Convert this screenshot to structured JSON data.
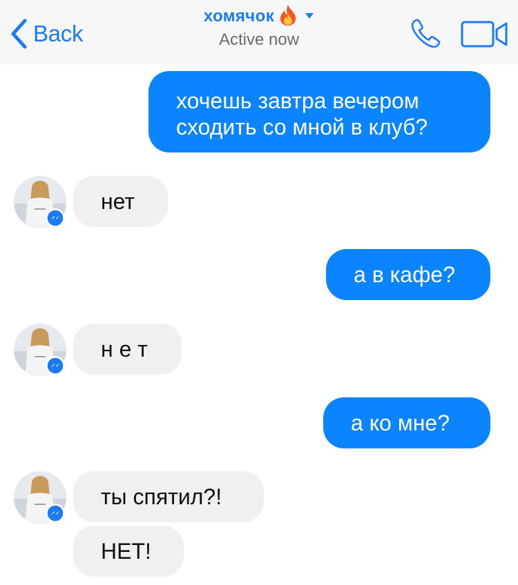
{
  "header": {
    "back_label": "Back",
    "contact_name": "хомячок",
    "status": "Active now",
    "emoji_icon": "fire-emoji-icon",
    "icons": {
      "back": "chevron-left-icon",
      "call": "phone-icon",
      "video": "video-camera-icon",
      "dropdown": "caret-down-icon"
    }
  },
  "colors": {
    "accent": "#1a7cf5",
    "outgoing_bubble": "#0a84ff",
    "incoming_bubble": "#f0f0f2",
    "header_bg": "#f7f7f8"
  },
  "messages": [
    {
      "direction": "outgoing",
      "lines": [
        "хочешь завтра вечером",
        "сходить со мной в клуб?"
      ]
    },
    {
      "direction": "incoming",
      "text": "нет"
    },
    {
      "direction": "outgoing",
      "text": "а в кафе?"
    },
    {
      "direction": "incoming",
      "text": "н е т"
    },
    {
      "direction": "outgoing",
      "text": "а ко мне?"
    },
    {
      "direction": "incoming",
      "text": "ты спятил?!"
    },
    {
      "direction": "incoming",
      "text": "НЕТ!"
    }
  ]
}
